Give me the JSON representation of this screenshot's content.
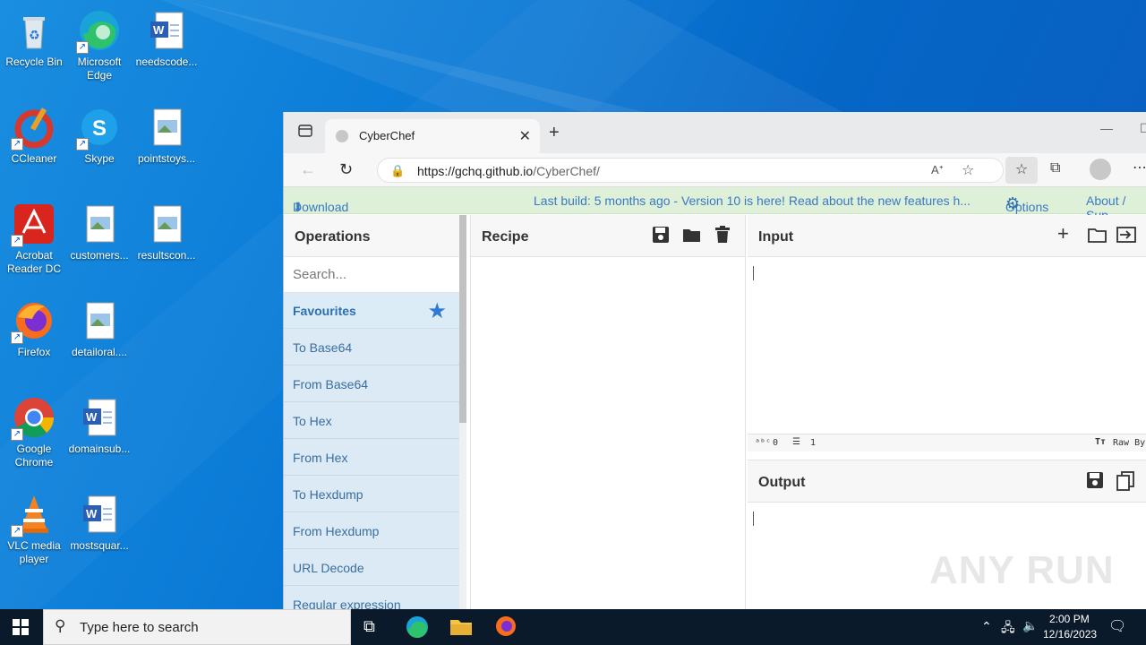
{
  "desktop": {
    "icons": [
      {
        "label": "Recycle Bin"
      },
      {
        "label": "Microsoft Edge"
      },
      {
        "label": "needscode..."
      },
      {
        "label": "CCleaner"
      },
      {
        "label": "Skype"
      },
      {
        "label": "pointstoys..."
      },
      {
        "label": "Acrobat Reader DC"
      },
      {
        "label": "customers..."
      },
      {
        "label": "resultscon..."
      },
      {
        "label": "Firefox"
      },
      {
        "label": "detailoral...."
      },
      {
        "label": "Google Chrome"
      },
      {
        "label": "domainsub..."
      },
      {
        "label": "VLC media player"
      },
      {
        "label": "mostsquar..."
      }
    ]
  },
  "browser": {
    "tab_title": "CyberChef",
    "url_host": "https://gchq.github.io",
    "url_path": "/CyberChef/"
  },
  "banner": {
    "download": "Download CyberChef",
    "build": "Last build: 5 months ago - Version 10 is here! Read about the new features h...",
    "options": "Options",
    "about": "About / Sup"
  },
  "operations": {
    "title": "Operations",
    "search_placeholder": "Search...",
    "favourites": "Favourites",
    "items": [
      "To Base64",
      "From Base64",
      "To Hex",
      "From Hex",
      "To Hexdump",
      "From Hexdump",
      "URL Decode",
      "Regular expression"
    ]
  },
  "recipe": {
    "title": "Recipe"
  },
  "input": {
    "title": "Input",
    "chars": "0",
    "lines": "1",
    "format": "Raw By"
  },
  "output": {
    "title": "Output"
  },
  "watermark": "ANY RUN",
  "taskbar": {
    "search_placeholder": "Type here to search",
    "time": "2:00 PM",
    "date": "12/16/2023"
  },
  "colors": {
    "banner_bg": "#dff0d8",
    "favourites_bg": "#dcecf7",
    "link_blue": "#3a79c3"
  }
}
